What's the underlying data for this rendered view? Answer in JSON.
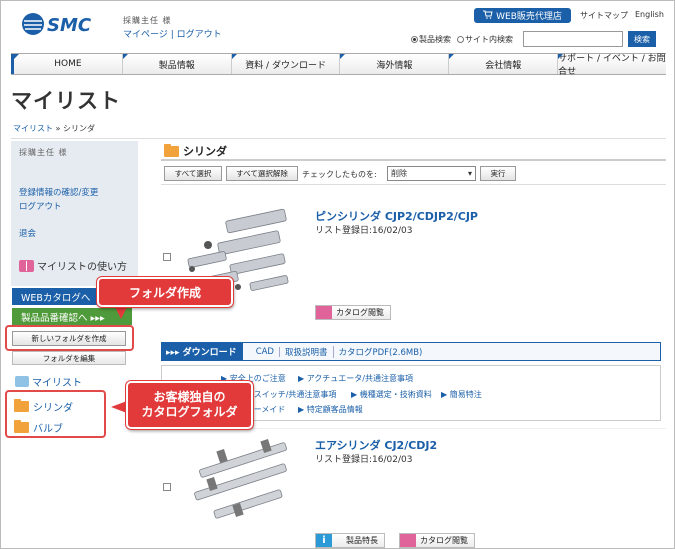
{
  "header": {
    "logo_text": "SMC",
    "user_name": "採購主任 様",
    "mypage": "マイページ",
    "separator": " | ",
    "logout": "ログアウト",
    "dealer_button": "WEB販売代理店",
    "sitemap": "サイトマップ",
    "english": "English",
    "search": {
      "product_label": "製品検索",
      "site_label": "サイト内検索",
      "input_value": "",
      "button": "検索"
    }
  },
  "nav": [
    "HOME",
    "製品情報",
    "資料 / ダウンロード",
    "海外情報",
    "会社情報",
    "サポート / イベント / お問合せ"
  ],
  "page_title": "マイリスト",
  "breadcrumb": {
    "root": "マイリスト",
    "sep": "»",
    "current": "シリンダ"
  },
  "sidebar": {
    "user_name": "採購主任 様",
    "links": [
      "登録情報の確認/変更",
      "ログアウト",
      "退会"
    ],
    "howto": "マイリストの使い方",
    "web_catalog": "WEBカタログへ",
    "product_check": "製品品番確認へ ▸▸▸",
    "new_folder": "新しいフォルダを作成",
    "edit_folder": "フォルダを編集",
    "mylist": "マイリスト",
    "folders": [
      "シリンダ",
      "バルブ"
    ]
  },
  "callouts": {
    "folder_create": "フォルダ作成",
    "custom_catalog_line1": "お客様独自の",
    "custom_catalog_line2": "カタログフォルダ"
  },
  "main": {
    "folder_title": "シリンダ",
    "select_all": "すべて選択",
    "deselect_all": "すべて選択解除",
    "checked_label": "チェックしたものを:",
    "action_value": "削除",
    "run": "実行",
    "products": [
      {
        "title": "ピンシリンダ CJP2/CDJP2/CJP",
        "date": "リスト登録日:16/02/03",
        "catalog": "カタログ閲覧"
      },
      {
        "title": "エアシリンダ CJ2/CDJ2",
        "date": "リスト登録日:16/02/03",
        "features": "製品特長",
        "catalog": "カタログ閲覧"
      }
    ],
    "download": {
      "tab": "▸▸▸ ダウンロード",
      "items": [
        "CAD",
        "取扱説明書",
        "カタログPDF(2.6MB)"
      ],
      "links": [
        "▶ 安全上のご注意",
        "▶ アクチュエータ/共通注意事項",
        "▶ オートスイッチ/共通注意事項",
        "▶ 機種選定・技術資料",
        "▶ 簡易特注",
        "▶ オーダーメイド",
        "▶ 特定顧客品情報"
      ]
    }
  },
  "colors": {
    "brand": "#1a5fa8",
    "callout": "#e23a3a",
    "green": "#4f9a3a"
  }
}
